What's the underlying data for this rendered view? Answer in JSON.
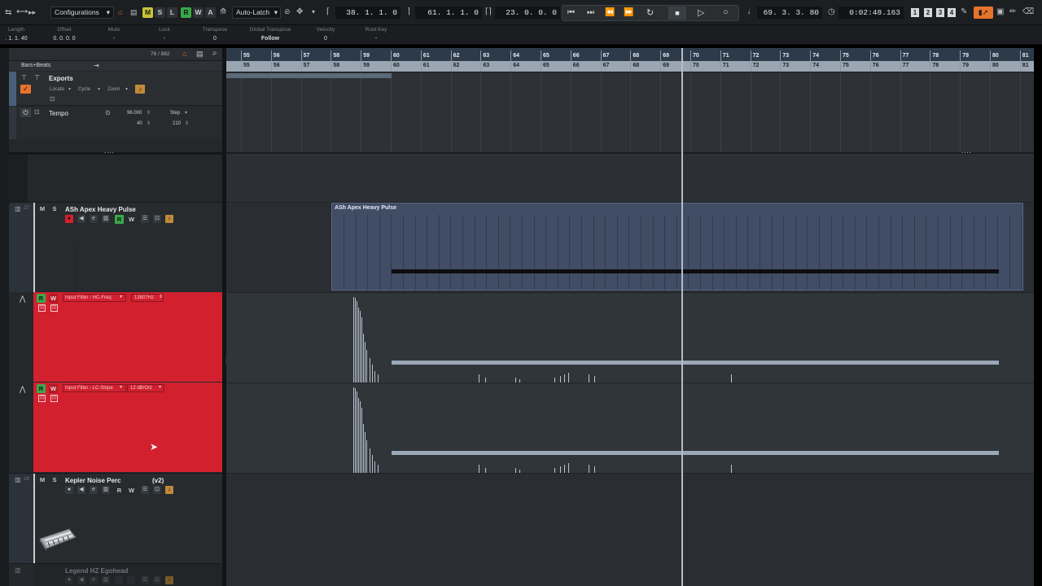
{
  "toolbar": {
    "configurations_label": "Configurations",
    "buttons": {
      "m": "M",
      "s": "S",
      "l": "L",
      "r": "R",
      "w": "W",
      "a": "A"
    },
    "automation_mode": "Auto-Latch",
    "left_locator": "38. 1. 1.  0",
    "right_locator": "61. 1. 1.  0",
    "punch_range": "23. 0. 0.  0",
    "position_bars": "69. 3. 3. 80",
    "position_time": "0:02:48.163",
    "quantize_numbers": [
      "1",
      "2",
      "3",
      "4"
    ]
  },
  "infoline": {
    "columns": [
      {
        "label": "Length",
        "value": ". 1. 1. 40"
      },
      {
        "label": "Offset",
        "value": "0. 0. 0.  0"
      },
      {
        "label": "Mute",
        "value": "-"
      },
      {
        "label": "Lock",
        "value": "-"
      },
      {
        "label": "Transpose",
        "value": "0"
      },
      {
        "label": "Global Transpose",
        "value": "Follow"
      },
      {
        "label": "Velocity",
        "value": "0"
      },
      {
        "label": "Root Key",
        "value": "-"
      }
    ]
  },
  "tracklist": {
    "track_count": "76 / 882",
    "bars_beats_label": "Bars+Beats",
    "exports": {
      "name": "Exports",
      "locate": "Locate",
      "cycle": "Cycle",
      "zoom": "Zoom"
    },
    "tempo": {
      "name": "Tempo",
      "value": "96.000",
      "mode": "Step",
      "min": "40",
      "max": "210"
    },
    "tracks": [
      {
        "number": "27",
        "name": "ASh Apex Heavy Pulse",
        "m": "M",
        "s": "S",
        "r": "R",
        "w": "W"
      },
      {
        "number": "28",
        "name": "Kepler Noise Perc",
        "version": "(v2)",
        "m": "M",
        "s": "S",
        "r": "R",
        "w": "W"
      },
      {
        "name": "Legend HZ Egohead"
      }
    ],
    "automation_lanes": [
      {
        "r": "R",
        "w": "W",
        "parameter": "Input Filter - HC-Freq",
        "value": "13807Hz"
      },
      {
        "r": "R",
        "w": "W",
        "parameter": "Input Filter - LC-Slope",
        "value": "12 dB/Oct"
      }
    ]
  },
  "ruler": {
    "bars": [
      "55",
      "56",
      "57",
      "58",
      "59",
      "60",
      "61",
      "62",
      "63",
      "64",
      "65",
      "66",
      "67",
      "68",
      "69",
      "70",
      "71",
      "72",
      "73",
      "74",
      "75",
      "76",
      "77",
      "78",
      "79",
      "80",
      "81"
    ]
  },
  "arrange": {
    "event_name": "ASh Apex Heavy Pulse"
  },
  "colors": {
    "accent_orange": "#e8732a",
    "mute_yellow": "#c8c23a",
    "read_green": "#3aa84a",
    "automation_red": "#d2202f",
    "event_blue": "#414c65"
  }
}
